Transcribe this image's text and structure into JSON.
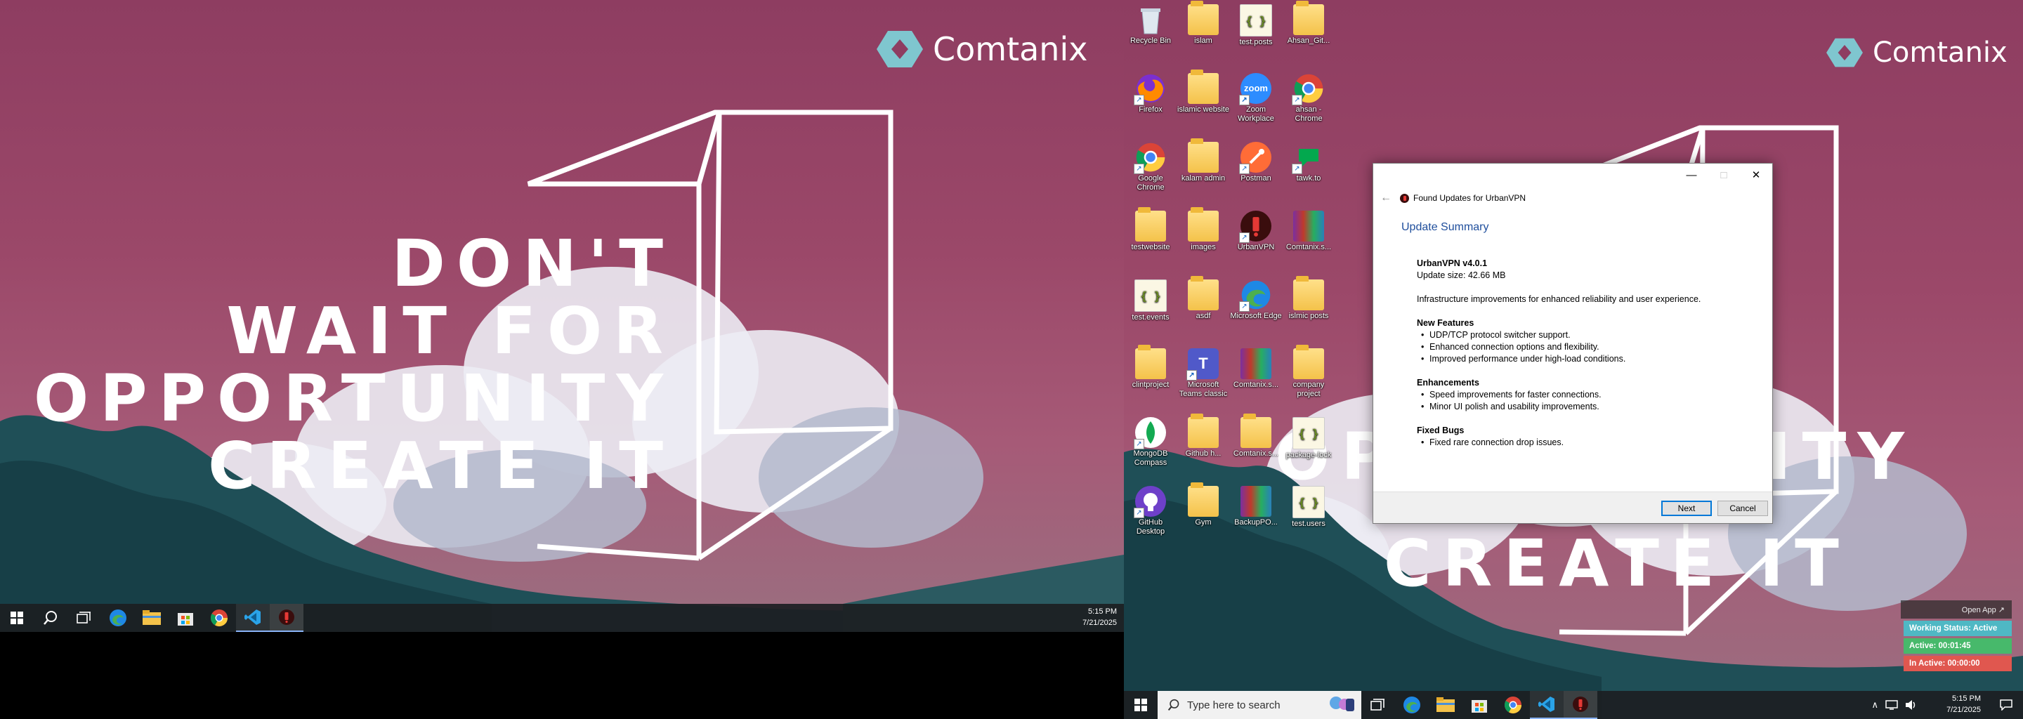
{
  "wallpaper": {
    "brand_name": "Comtanix",
    "quote_lines": [
      "DON'T",
      "WAIT FOR",
      "OPPORTUNITY",
      "CREATE IT"
    ],
    "colors": {
      "sky": "#9b4869",
      "trees": "#1f4f57",
      "brand_mark": "#7fc6cf"
    }
  },
  "left_taskbar": {
    "icons": [
      "windows-start-icon",
      "search-icon",
      "task-view-icon",
      "edge-icon",
      "file-explorer-icon",
      "microsoft-store-icon",
      "chrome-icon",
      "vscode-icon",
      "urbanvpn-icon"
    ],
    "time": "5:15 PM",
    "date": "7/21/2025"
  },
  "right_taskbar": {
    "search_placeholder": "Type here to search",
    "time": "5:15 PM",
    "date": "7/21/2025"
  },
  "desktop_icons": [
    {
      "label": "Recycle Bin",
      "kind": "recycle"
    },
    {
      "label": "islam",
      "kind": "folder"
    },
    {
      "label": "test.posts",
      "kind": "json"
    },
    {
      "label": "Ahsan_Git...",
      "kind": "folder"
    },
    {
      "label": "Firefox",
      "kind": "firefox"
    },
    {
      "label": "islamic website",
      "kind": "folder"
    },
    {
      "label": "Zoom Workplace",
      "kind": "zoom"
    },
    {
      "label": "ahsan - Chrome",
      "kind": "chrome"
    },
    {
      "label": "Google Chrome",
      "kind": "chrome"
    },
    {
      "label": "kalam admin",
      "kind": "folder"
    },
    {
      "label": "Postman",
      "kind": "postman"
    },
    {
      "label": "tawk.to",
      "kind": "tawk"
    },
    {
      "label": "testwebsite",
      "kind": "folder"
    },
    {
      "label": "images",
      "kind": "folder"
    },
    {
      "label": "UrbanVPN",
      "kind": "urbanvpn"
    },
    {
      "label": "Comtanix.s...",
      "kind": "rar"
    },
    {
      "label": "test.events",
      "kind": "json"
    },
    {
      "label": "asdf",
      "kind": "folder"
    },
    {
      "label": "Microsoft Edge",
      "kind": "edge"
    },
    {
      "label": "islmic posts",
      "kind": "folder"
    },
    {
      "label": "clintproject",
      "kind": "folder"
    },
    {
      "label": "Microsoft Teams classic",
      "kind": "teams"
    },
    {
      "label": "Comtanix.s...",
      "kind": "rar"
    },
    {
      "label": "company project",
      "kind": "folder"
    },
    {
      "label": "MongoDB Compass",
      "kind": "mongodb"
    },
    {
      "label": "Github h...",
      "kind": "folder"
    },
    {
      "label": "Comtanix.s...",
      "kind": "folder"
    },
    {
      "label": "package-lock",
      "kind": "json"
    },
    {
      "label": "GitHub Desktop",
      "kind": "github"
    },
    {
      "label": "Gym",
      "kind": "folder"
    },
    {
      "label": "BackupPO...",
      "kind": "rar"
    },
    {
      "label": "test.users",
      "kind": "json"
    }
  ],
  "dialog": {
    "title": "Found Updates for UrbanVPN",
    "section_title": "Update Summary",
    "version_line": "UrbanVPN v4.0.1",
    "size_line": "Update size: 42.66 MB",
    "description": "Infrastructure improvements for enhanced reliability and user experience.",
    "new_features_heading": "New Features",
    "new_features": [
      "UDP/TCP protocol switcher support.",
      "Enhanced connection options and flexibility.",
      "Improved performance under high-load conditions."
    ],
    "enhancements_heading": "Enhancements",
    "enhancements": [
      "Speed improvements for faster connections.",
      "Minor UI polish and usability improvements."
    ],
    "fixed_bugs_heading": "Fixed Bugs",
    "fixed_bugs": [
      "Fixed rare connection drop issues."
    ],
    "next_label": "Next",
    "cancel_label": "Cancel"
  },
  "tracker_widget": {
    "open_app_label": "Open App ↗",
    "working_status": "Working Status: Active",
    "active_time": "Active: 00:01:45",
    "inactive_time": "In Active: 00:00:00",
    "colors": {
      "status": "#4fb8c4",
      "active": "#47b96b",
      "inactive": "#e0574f"
    }
  }
}
